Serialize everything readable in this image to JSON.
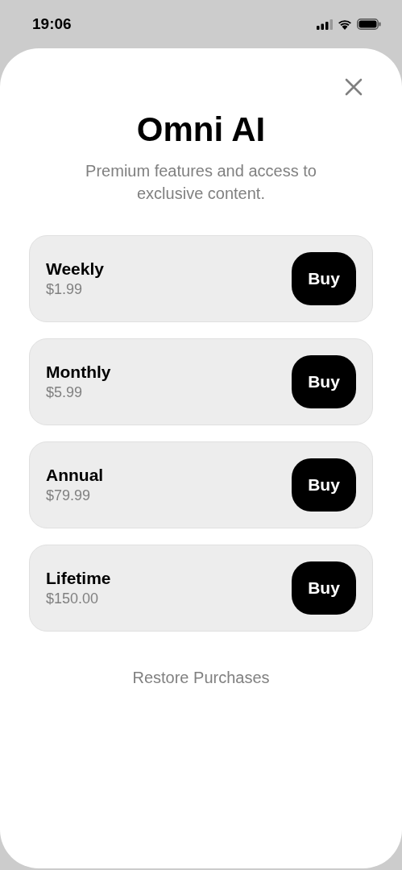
{
  "status_bar": {
    "time": "19:06"
  },
  "sheet": {
    "title": "Omni AI",
    "subtitle": "Premium features and access to exclusive content.",
    "plans": [
      {
        "name": "Weekly",
        "price": "$1.99",
        "button": "Buy"
      },
      {
        "name": "Monthly",
        "price": "$5.99",
        "button": "Buy"
      },
      {
        "name": "Annual",
        "price": "$79.99",
        "button": "Buy"
      },
      {
        "name": "Lifetime",
        "price": "$150.00",
        "button": "Buy"
      }
    ],
    "restore": "Restore Purchases"
  }
}
